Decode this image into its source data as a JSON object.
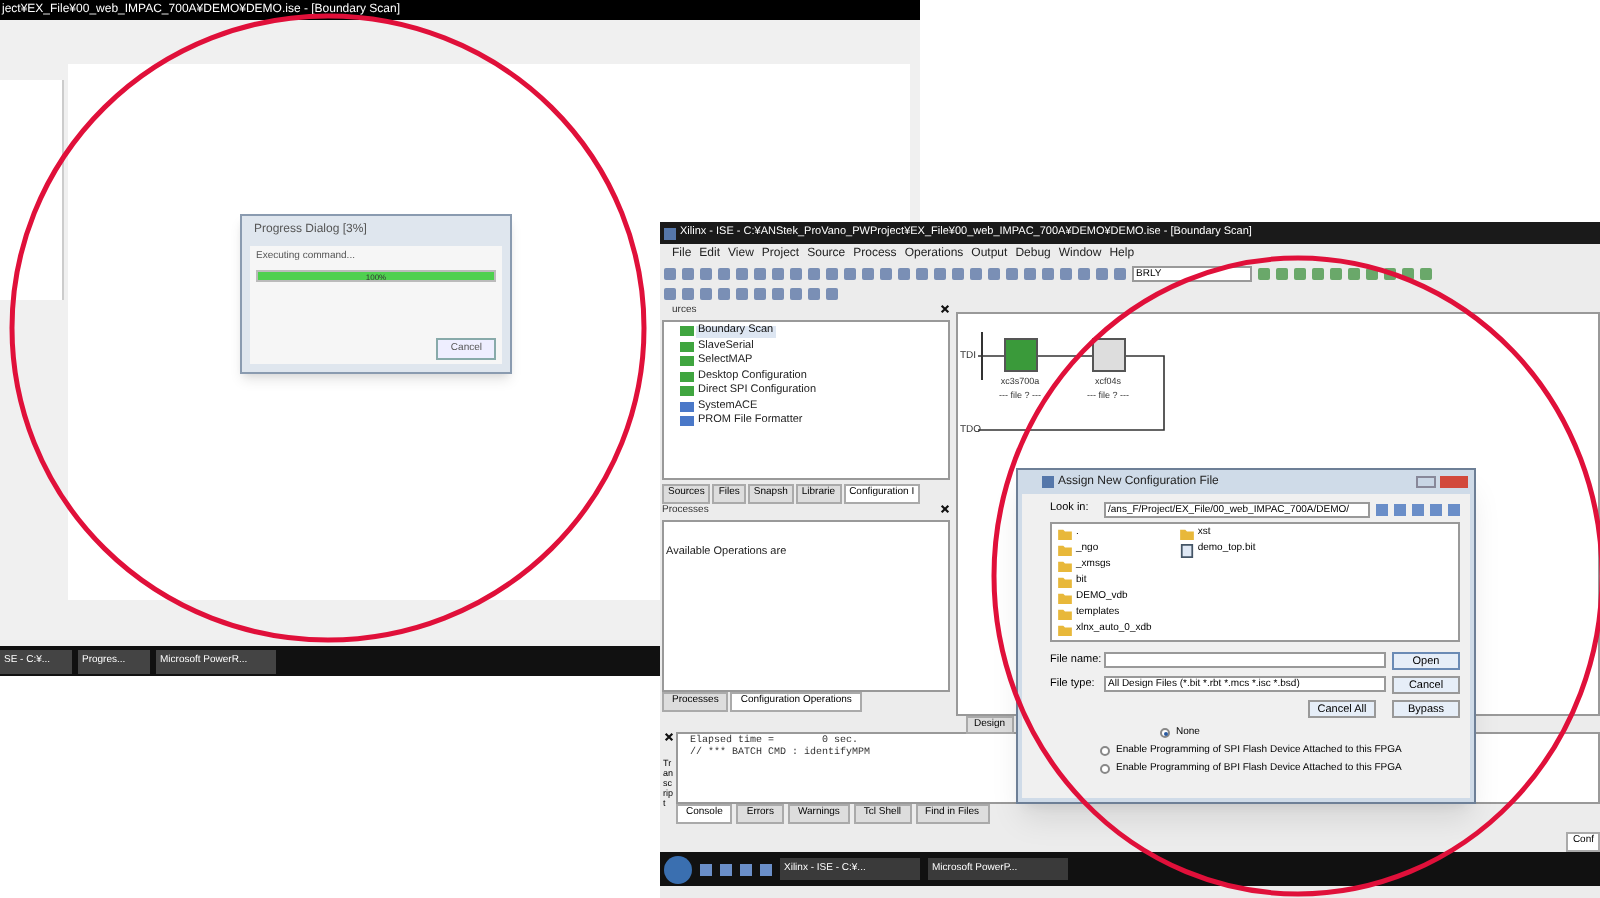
{
  "left_screen": {
    "title": "ject¥EX_File¥00_web_IMPAC_700A¥DEMO¥DEMO.ise - [Boundary Scan]",
    "progress_dialog": {
      "title": "Progress Dialog [3%]",
      "message": "Executing command...",
      "level": 1,
      "reading": "100%",
      "button": "Cancel"
    },
    "taskbar": [
      {
        "label": "SE - C:¥..."
      },
      {
        "label": "Progres..."
      },
      {
        "label": "Microsoft PowerR..."
      }
    ]
  },
  "right_screen": {
    "title": "Xilinx - ISE - C:¥ANStek_ProVano_PWProject¥EX_File¥00_web_IMPAC_700A¥DEMO¥DEMO.ise - [Boundary Scan]",
    "menu": [
      "File",
      "Edit",
      "View",
      "Project",
      "Source",
      "Process",
      "Operations",
      "Output",
      "Debug",
      "Window",
      "Help"
    ],
    "toolbar_combo": "BRLY",
    "sources": {
      "title": "urces",
      "items": [
        {
          "label": "Boundary Scan",
          "selected": true
        },
        {
          "label": "SlaveSerial",
          "selected": false
        },
        {
          "label": "SelectMAP",
          "selected": false
        },
        {
          "label": "Desktop Configuration",
          "selected": false
        },
        {
          "label": "Direct SPI Configuration",
          "selected": false
        },
        {
          "label": "SystemACE",
          "selected": false
        },
        {
          "label": "PROM File Formatter",
          "selected": false
        }
      ],
      "tabs": [
        {
          "label": "Sources",
          "selected": false
        },
        {
          "label": "Files",
          "selected": false
        },
        {
          "label": "Snapsh",
          "selected": false
        },
        {
          "label": "Librarie",
          "selected": false
        },
        {
          "label": "Configuration I",
          "selected": true
        }
      ]
    },
    "processes": {
      "title": "Processes",
      "text": "Available Operations are",
      "tabs": [
        {
          "label": "Processes",
          "selected": false
        },
        {
          "label": "Configuration Operations",
          "selected": true
        }
      ]
    },
    "canvas": {
      "tdi": "TDI",
      "tdo": "TDO",
      "chips": [
        {
          "name": "xc3s700a",
          "file": "--- file ? ---",
          "selected": true
        },
        {
          "name": "xcf04s",
          "file": "--- file ? ---",
          "selected": false
        }
      ],
      "tab": "Design"
    },
    "dialog": {
      "title": "Assign New Configuration File",
      "look_in_label": "Look in:",
      "look_in": "/ans_F/Project/EX_File/00_web_IMPAC_700A/DEMO/",
      "files": [
        {
          "name": ".",
          "kind": "folder"
        },
        {
          "name": "_ngo",
          "kind": "folder"
        },
        {
          "name": "_xmsgs",
          "kind": "folder"
        },
        {
          "name": "bit",
          "kind": "folder"
        },
        {
          "name": "DEMO_vdb",
          "kind": "folder"
        },
        {
          "name": "templates",
          "kind": "folder"
        },
        {
          "name": "xlnx_auto_0_xdb",
          "kind": "folder"
        },
        {
          "name": "xst",
          "kind": "folder"
        },
        {
          "name": "demo_top.bit",
          "kind": "file"
        }
      ],
      "file_name_label": "File name:",
      "file_type_label": "File type:",
      "file_type": "All Design Files (*.bit *.rbt *.mcs *.isc *.bsd)",
      "buttons": [
        "Open",
        "Cancel",
        "Cancel All",
        "Bypass"
      ],
      "options": [
        {
          "label": "None",
          "selected": true
        },
        {
          "label": "Enable Programming of SPI Flash Device Attached to this FPGA",
          "selected": false
        },
        {
          "label": "Enable Programming of BPI Flash Device Attached to this FPGA",
          "selected": false
        }
      ]
    },
    "transcript": {
      "label": "Transcript",
      "lines": [
        "Elapsed time =        0 sec.",
        "// *** BATCH CMD : identifyMPM"
      ],
      "tabs": [
        {
          "label": "Console",
          "selected": true
        },
        {
          "label": "Errors",
          "selected": false
        },
        {
          "label": "Warnings",
          "selected": false
        },
        {
          "label": "Tcl Shell",
          "selected": false
        },
        {
          "label": "Find in Files",
          "selected": false
        }
      ]
    },
    "status_text": "Conf",
    "taskbar": [
      {
        "label": "Xilinx - ISE - C:¥..."
      },
      {
        "label": "Microsoft PowerP..."
      }
    ]
  }
}
